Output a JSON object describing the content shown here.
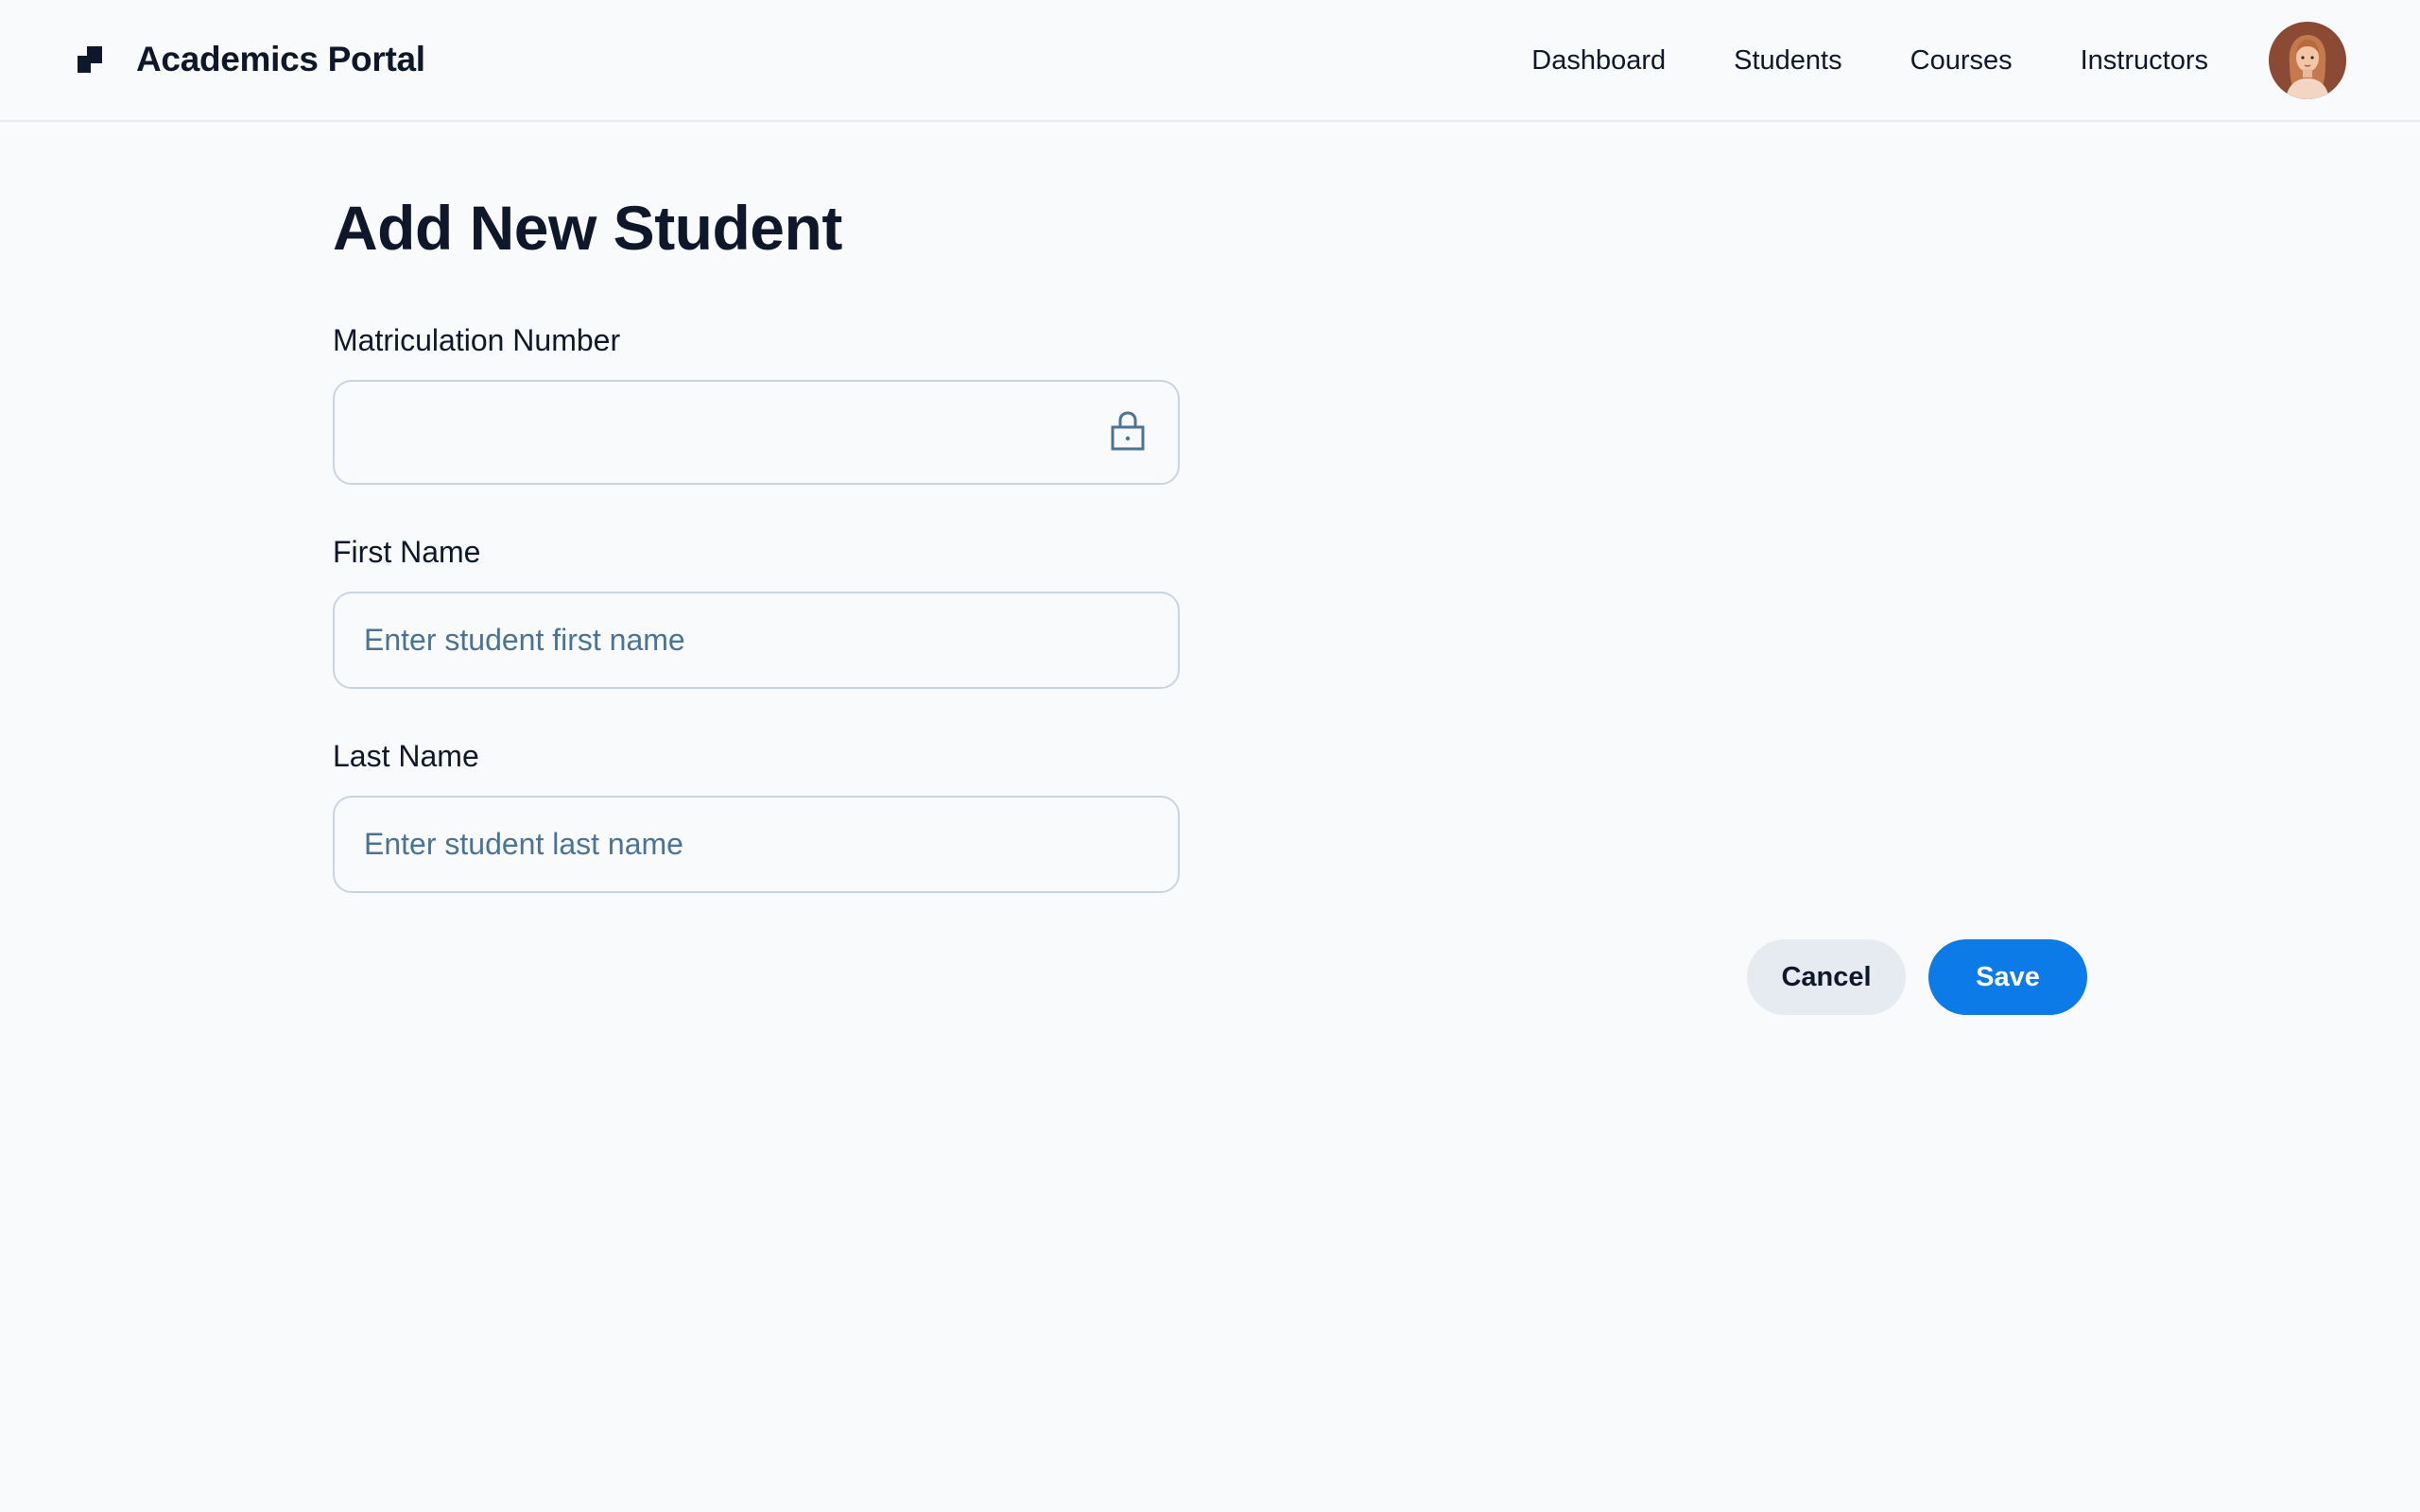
{
  "app": {
    "title": "Academics Portal"
  },
  "nav": {
    "items": [
      {
        "label": "Dashboard"
      },
      {
        "label": "Students"
      },
      {
        "label": "Courses"
      },
      {
        "label": "Instructors"
      }
    ],
    "avatar_icon": "user-avatar"
  },
  "page": {
    "title": "Add New Student"
  },
  "form": {
    "matriculation": {
      "label": "Matriculation Number",
      "value": "",
      "placeholder": "",
      "icon": "lock-icon"
    },
    "first_name": {
      "label": "First Name",
      "value": "",
      "placeholder": "Enter student first name"
    },
    "last_name": {
      "label": "Last Name",
      "value": "",
      "placeholder": "Enter student last name"
    }
  },
  "actions": {
    "cancel_label": "Cancel",
    "save_label": "Save"
  },
  "colors": {
    "accent": "#0c7be8",
    "background": "#f8fafc",
    "placeholder": "#4a7396",
    "secondary_button": "#e6ebf2"
  }
}
